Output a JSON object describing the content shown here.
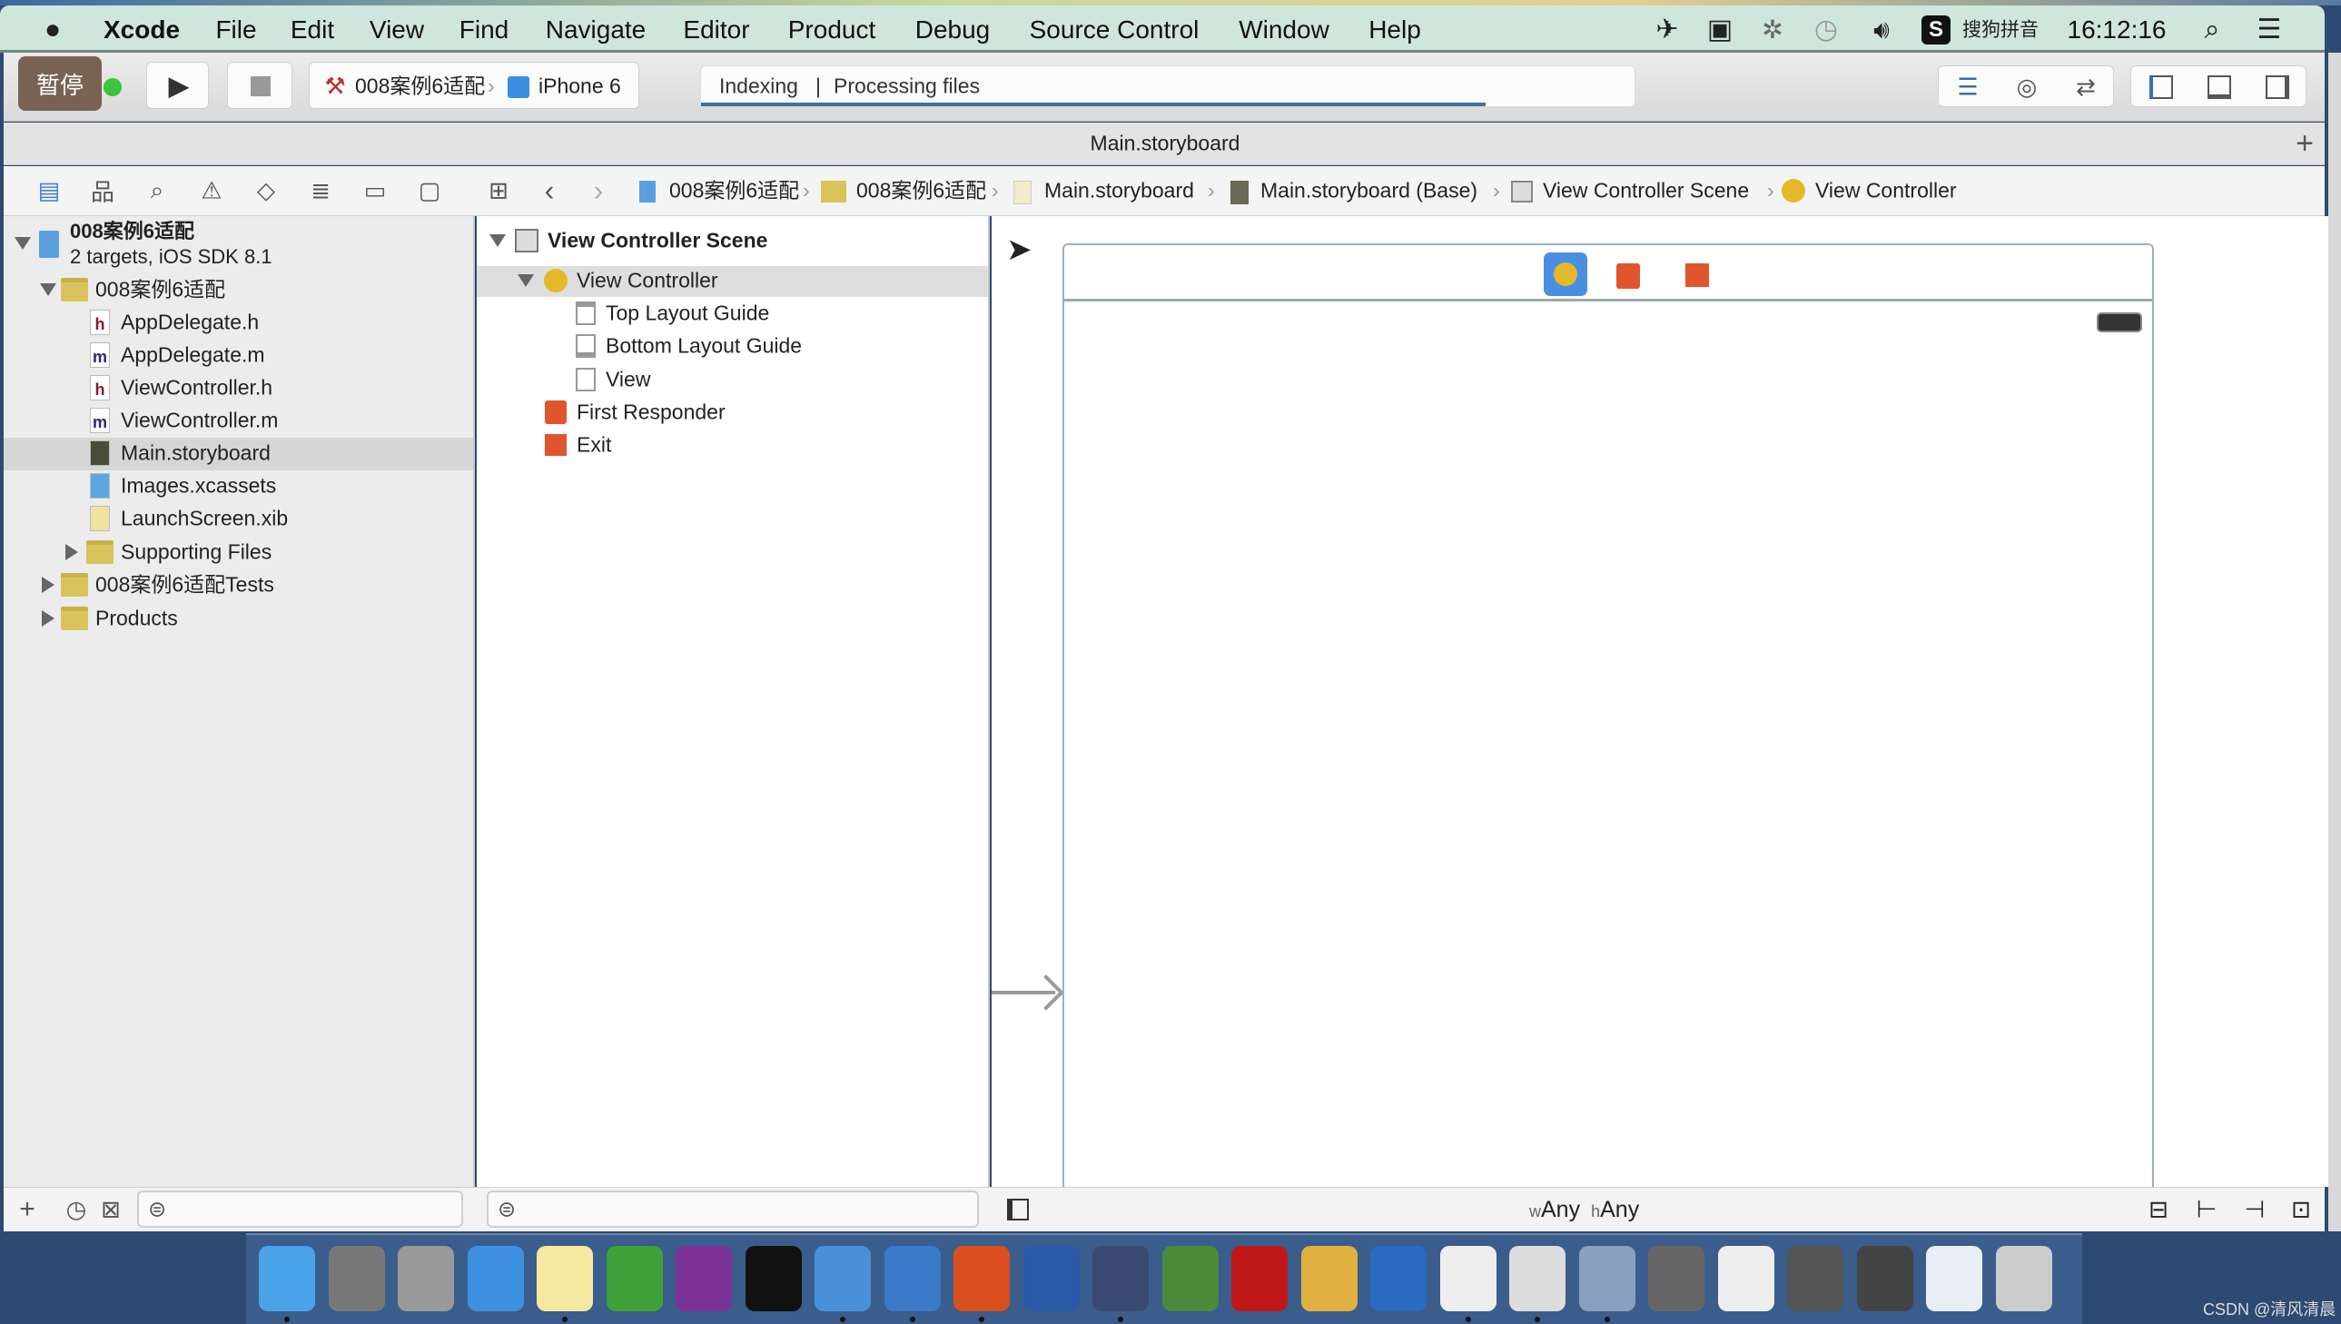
{
  "menubar": {
    "apple": "",
    "items": [
      "Xcode",
      "File",
      "Edit",
      "View",
      "Find",
      "Navigate",
      "Editor",
      "Product",
      "Debug",
      "Source Control",
      "Window",
      "Help"
    ],
    "input_method": "搜狗拼音",
    "clock": "16:12:16"
  },
  "toolbar": {
    "pause_badge": "暂停",
    "scheme": "008案例6适配",
    "device": "iPhone 6",
    "activity_left": "Indexing",
    "activity_sep": "|",
    "activity_right": "Processing files",
    "progress": 0.84
  },
  "tab": {
    "title": "Main.storyboard",
    "add": "+"
  },
  "jumpbar": {
    "items": [
      "008案例6适配",
      "008案例6适配",
      "Main.storyboard",
      "Main.storyboard (Base)",
      "View Controller Scene",
      "View Controller"
    ]
  },
  "navigator": {
    "project": {
      "name": "008案例6适配",
      "subtitle": "2 targets, iOS SDK 8.1"
    },
    "group": "008案例6适配",
    "files": [
      {
        "name": "AppDelegate.h",
        "type": "h"
      },
      {
        "name": "AppDelegate.m",
        "type": "m"
      },
      {
        "name": "ViewController.h",
        "type": "h"
      },
      {
        "name": "ViewController.m",
        "type": "m"
      },
      {
        "name": "Main.storyboard",
        "type": "storyboard",
        "selected": true
      },
      {
        "name": "Images.xcassets",
        "type": "xcassets"
      },
      {
        "name": "LaunchScreen.xib",
        "type": "xib"
      }
    ],
    "supporting": "Supporting Files",
    "tests": "008案例6适配Tests",
    "products": "Products"
  },
  "outline": {
    "scene": "View Controller Scene",
    "vc": "View Controller",
    "children": [
      "Top Layout Guide",
      "Bottom Layout Guide",
      "View"
    ],
    "first_responder": "First Responder",
    "exit": "Exit"
  },
  "canvas": {
    "size_class_w": "w",
    "size_class_w_val": "Any",
    "size_class_h": "h",
    "size_class_h_val": "Any"
  },
  "colors": {
    "accent": "#3a6fa8",
    "selection": "#d6d6d6",
    "vc_icon": "#e3b92a",
    "exit_icon": "#e0552e"
  },
  "dock": {
    "apps": [
      {
        "name": "finder",
        "color": "#4aa3e8",
        "dot": true
      },
      {
        "name": "system-preferences",
        "color": "#777"
      },
      {
        "name": "launchpad",
        "color": "#999"
      },
      {
        "name": "safari",
        "color": "#3d8fe0"
      },
      {
        "name": "notes",
        "color": "#f5e8a0",
        "dot": true
      },
      {
        "name": "excel",
        "color": "#3fa03a"
      },
      {
        "name": "onenote",
        "color": "#7b3294"
      },
      {
        "name": "terminal",
        "color": "#111"
      },
      {
        "name": "xcode",
        "color": "#4a90d9",
        "dot": true
      },
      {
        "name": "xcode-beta",
        "color": "#3a7ac8",
        "dot": true
      },
      {
        "name": "powerpoint",
        "color": "#d9501e",
        "dot": true
      },
      {
        "name": "scissors-app",
        "color": "#2a5aa8"
      },
      {
        "name": "photo-app",
        "color": "#3a4a70",
        "dot": true
      },
      {
        "name": "pro-app",
        "color": "#4a8a3a"
      },
      {
        "name": "filezilla",
        "color": "#c01818"
      },
      {
        "name": "paint-app",
        "color": "#e0b040"
      },
      {
        "name": "word",
        "color": "#2a6ac0"
      },
      {
        "name": "instruments",
        "color": "#eee",
        "dot": true
      },
      {
        "name": "instruments-2",
        "color": "#ddd",
        "dot": true
      },
      {
        "name": "preview",
        "color": "#8aa0c0",
        "dot": true
      },
      {
        "name": "window-1",
        "color": "#666"
      },
      {
        "name": "window-2",
        "color": "#eee"
      },
      {
        "name": "window-3",
        "color": "#555"
      },
      {
        "name": "window-4",
        "color": "#444"
      },
      {
        "name": "window-5",
        "color": "#e8eef5"
      },
      {
        "name": "trash",
        "color": "#ccc"
      }
    ]
  },
  "watermark": "CSDN @清风清晨"
}
